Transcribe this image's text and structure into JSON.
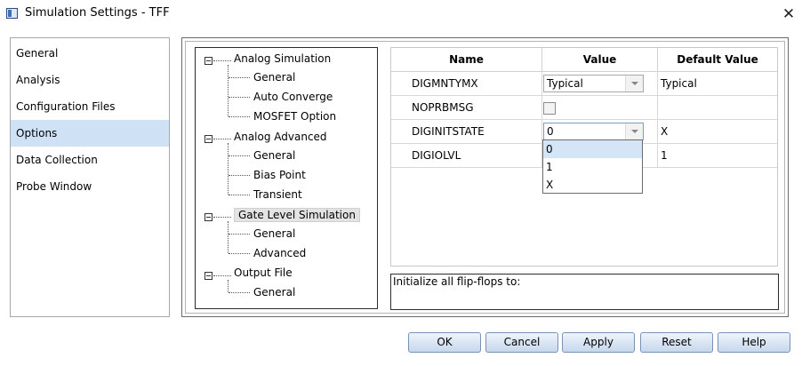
{
  "window": {
    "title": "Simulation Settings - TFF",
    "close_glyph": "✕"
  },
  "left_nav": {
    "items": [
      {
        "label": "General",
        "selected": false
      },
      {
        "label": "Analysis",
        "selected": false
      },
      {
        "label": "Configuration Files",
        "selected": false
      },
      {
        "label": "Options",
        "selected": true
      },
      {
        "label": "Data Collection",
        "selected": false
      },
      {
        "label": "Probe Window",
        "selected": false
      }
    ]
  },
  "tree": {
    "groups": [
      {
        "label": "Analog Simulation",
        "expanded": true,
        "children": [
          "General",
          "Auto Converge",
          "MOSFET Option"
        ]
      },
      {
        "label": "Analog Advanced",
        "expanded": true,
        "children": [
          "General",
          "Bias Point",
          "Transient"
        ]
      },
      {
        "label": "Gate Level Simulation",
        "expanded": true,
        "selected": true,
        "children": [
          "General",
          "Advanced"
        ]
      },
      {
        "label": "Output File",
        "expanded": true,
        "children": [
          "General"
        ]
      }
    ]
  },
  "grid": {
    "headers": [
      "Name",
      "Value",
      "Default Value"
    ],
    "rows": [
      {
        "name": "DIGMNTYMX",
        "value": "Typical",
        "value_type": "combo",
        "default": "Typical"
      },
      {
        "name": "NOPRBMSG",
        "value": "",
        "value_type": "checkbox",
        "checked": false,
        "default": ""
      },
      {
        "name": "DIGINITSTATE",
        "value": "0",
        "value_type": "combo",
        "default": "X"
      },
      {
        "name": "DIGIOLVL",
        "value": "",
        "value_type": "combo",
        "default": "1"
      }
    ]
  },
  "dropdown": {
    "options": [
      "0",
      "1",
      "X"
    ],
    "selected": "0"
  },
  "description": {
    "text": "Initialize all flip-flops to:"
  },
  "buttons": {
    "ok": "OK",
    "cancel": "Cancel",
    "apply": "Apply",
    "reset": "Reset",
    "help": "Help"
  },
  "colors": {
    "nav_selected": "#cfe2f5",
    "dropdown_selected": "#d4e5f7",
    "button_border": "#7a92b3"
  }
}
